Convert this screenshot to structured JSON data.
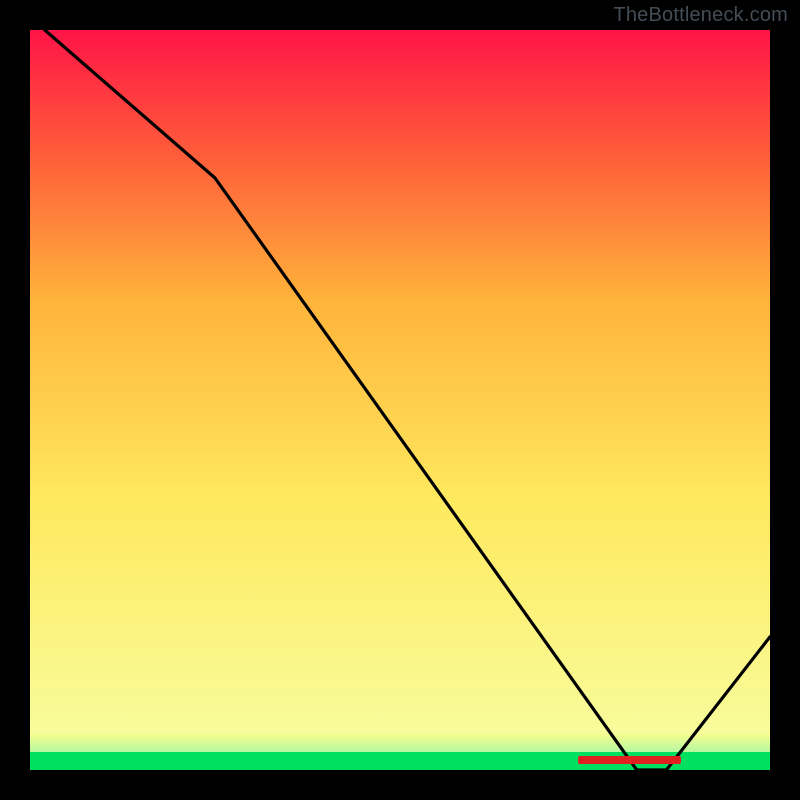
{
  "watermark": "TheBottleneck.com",
  "chart_data": {
    "type": "line",
    "title": "",
    "xlabel": "",
    "ylabel": "",
    "xlim": [
      0,
      100
    ],
    "ylim": [
      0,
      100
    ],
    "grid": false,
    "legend": false,
    "series": [
      {
        "name": "bottleneck-curve",
        "x": [
          2,
          25,
          82,
          86,
          100
        ],
        "y": [
          100,
          80,
          0,
          0,
          18
        ],
        "color": "#000000"
      }
    ],
    "annotations": [
      {
        "name": "optimal-range-marker",
        "x_start": 74,
        "x_end": 88,
        "y": 1.3,
        "color": "#e02020"
      }
    ],
    "background_gradient": {
      "stops": [
        {
          "pct": 0,
          "color": "#00e060"
        },
        {
          "pct": 2.4,
          "color": "#00e060"
        },
        {
          "pct": 2.4,
          "color": "#f5ff8f"
        },
        {
          "pct": 5,
          "color": "#f7ffa5"
        },
        {
          "pct": 36,
          "color": "#ffe95e"
        },
        {
          "pct": 64,
          "color": "#ffb33a"
        },
        {
          "pct": 84,
          "color": "#ff5a3a"
        },
        {
          "pct": 100,
          "color": "#ff1447"
        }
      ]
    }
  }
}
